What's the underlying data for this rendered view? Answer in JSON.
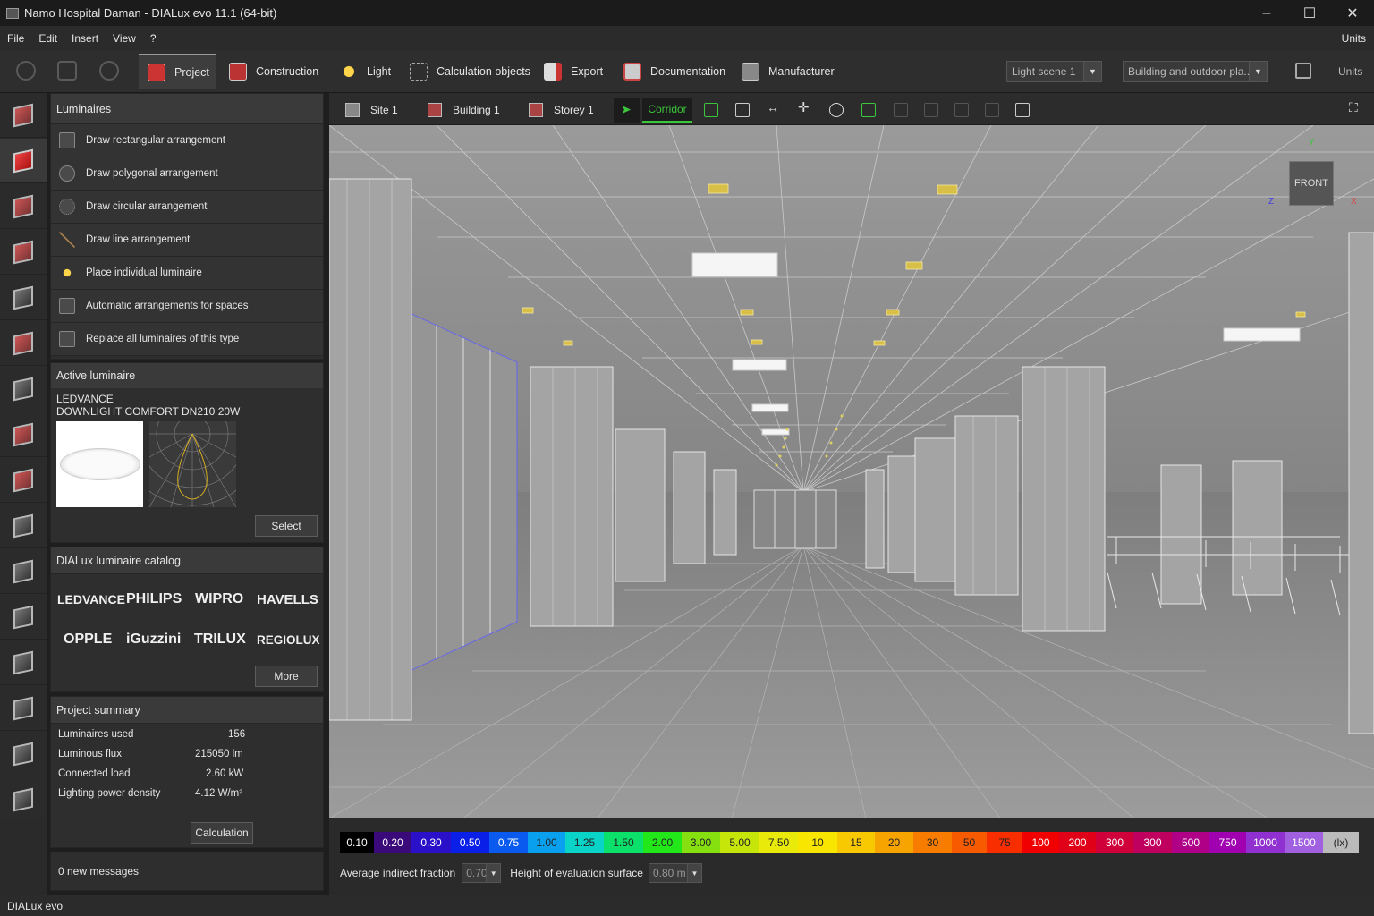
{
  "window": {
    "title": "Namo Hospital Daman - DIALux evo 11.1 (64-bit)",
    "minimize": "–",
    "maximize": "☐",
    "close": "✕"
  },
  "menu": {
    "items": [
      "File",
      "Edit",
      "Insert",
      "View",
      "?"
    ],
    "units": "Units"
  },
  "toolbar": {
    "tabs": [
      "Project",
      "Construction",
      "Light",
      "Calculation objects",
      "Export",
      "Documentation",
      "Manufacturer"
    ],
    "active_tab": "Project",
    "light_scene": "Light scene 1",
    "scene_filter": "Building and outdoor pla...",
    "units_label": "Units"
  },
  "luminaires_panel": {
    "title": "Luminaires",
    "items": [
      "Draw rectangular arrangement",
      "Draw polygonal arrangement",
      "Draw circular arrangement",
      "Draw line arrangement",
      "Place individual luminaire",
      "Automatic arrangements for spaces",
      "Replace all luminaires of this type"
    ]
  },
  "active_luminaire": {
    "title": "Active luminaire",
    "manufacturer": "LEDVANCE",
    "model": "DOWNLIGHT COMFORT DN210 20W",
    "select_label": "Select"
  },
  "catalog": {
    "title": "DIALux luminaire catalog",
    "brands_row1": [
      "LEDVANCE",
      "PHILIPS",
      "WIPRO",
      "HAVELLS"
    ],
    "brands_row2": [
      "OPPLE",
      "iGuzzini",
      "TRILUX",
      "REGIOLUX"
    ],
    "more_label": "More"
  },
  "summary": {
    "title": "Project summary",
    "rows": [
      {
        "label": "Luminaires used",
        "value": "156"
      },
      {
        "label": "Luminous flux",
        "value": "215050 lm"
      },
      {
        "label": "Connected load",
        "value": "2.60 kW"
      },
      {
        "label": "Lighting power density",
        "value": "4.12 W/m²"
      }
    ],
    "calc_label": "Calculation"
  },
  "messages": "0 new messages",
  "view_tabs": {
    "site": "Site 1",
    "building": "Building 1",
    "storey": "Storey 1",
    "space": "Corridor"
  },
  "viewport": {
    "cube_label": "FRONT",
    "axis_y": "Y",
    "axis_x": "X",
    "axis_z": "Z"
  },
  "legend": {
    "values": [
      "0.10",
      "0.20",
      "0.30",
      "0.50",
      "0.75",
      "1.00",
      "1.25",
      "1.50",
      "2.00",
      "3.00",
      "5.00",
      "7.50",
      "10",
      "15",
      "20",
      "30",
      "50",
      "75",
      "100",
      "200",
      "300",
      "300",
      "500",
      "750",
      "1000",
      "1500",
      "(lx)"
    ],
    "colors": [
      "#000000",
      "#3a0a7a",
      "#2a10c8",
      "#0a1fe8",
      "#0a5af0",
      "#0aa0f0",
      "#0ad4c8",
      "#0ae06a",
      "#22e81a",
      "#86e010",
      "#c6e60a",
      "#eaea0a",
      "#f8e600",
      "#f8c800",
      "#f8a400",
      "#f87c00",
      "#f85a00",
      "#f82e00",
      "#f00000",
      "#e00018",
      "#d0003a",
      "#c0005e",
      "#b00088",
      "#a000b0",
      "#9030d0",
      "#a060e0",
      "#bbbbbb"
    ]
  },
  "eval": {
    "indirect_label": "Average indirect fraction",
    "indirect_value": "0.70",
    "height_label": "Height of evaluation surface",
    "height_value": "0.80 m"
  },
  "status": "DIALux evo"
}
